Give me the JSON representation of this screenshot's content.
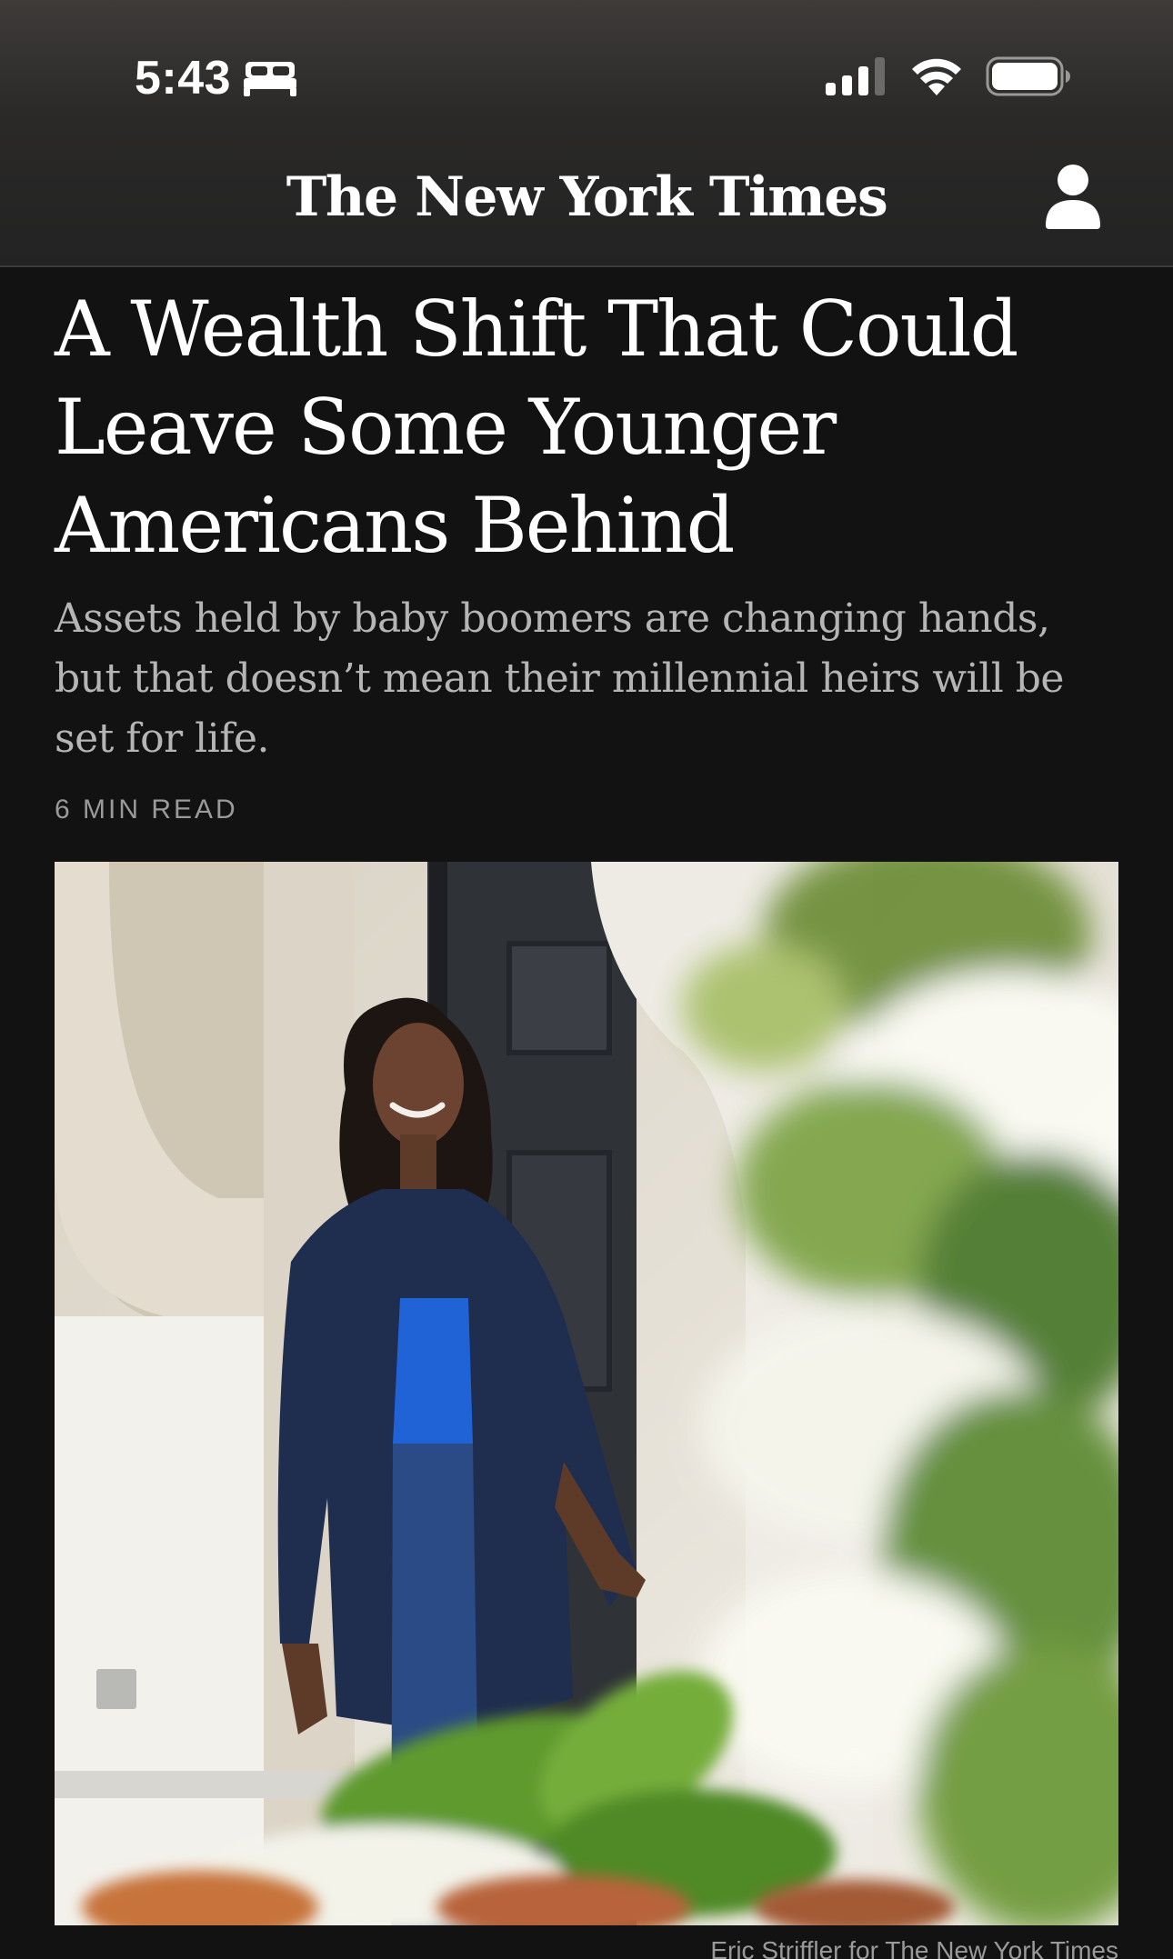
{
  "status_bar": {
    "time": "5:43",
    "focus_icon": "bed-icon",
    "signal_icon": "cellular-signal-icon",
    "wifi_icon": "wifi-icon",
    "battery_icon": "battery-icon"
  },
  "header": {
    "masthead": "The New York Times",
    "account_icon": "person-icon"
  },
  "article": {
    "title_lines": [
      "A Wealth Shift That Could",
      "Leave Some Younger",
      "Americans Behind"
    ],
    "summary": "Assets held by baby boomers are changing hands, but that doesn’t mean their millennial heirs will be set for life.",
    "read_time": "6 MIN READ",
    "photo_credit": "Eric Striffler for The New York Times"
  },
  "colors": {
    "background": "#121212",
    "header_top": "#3e3b39",
    "header_bottom": "#232323",
    "summary_text": "#b5b5b5",
    "meta_text": "#9a9a9a"
  }
}
